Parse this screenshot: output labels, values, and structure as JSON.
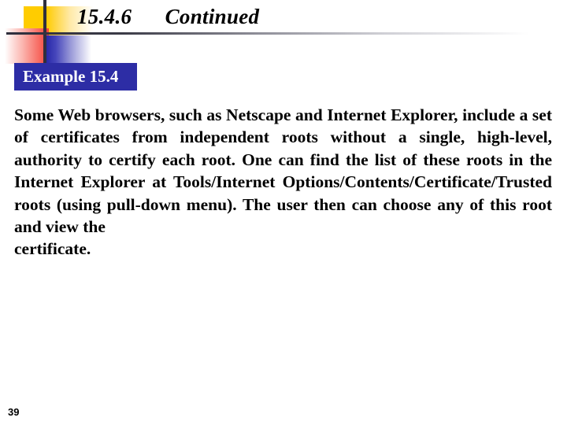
{
  "slide": {
    "title": "15.4.6      Continued",
    "page_number": "39",
    "badge": {
      "label": "Example 15.4",
      "background_color": "#2d2da5",
      "text_color": "#ffffff"
    },
    "body": {
      "paragraph": "Some Web browsers, such as Netscape and Internet Explorer, include a set of certificates from independent roots without a single, high-level, authority to certify each root. One can find the list of these roots in the Internet Explorer at Tools/Internet Options/Contents/Certificate/Trusted roots (using pull-down menu). The user then can choose any of this root and view the",
      "last_line": "certificate.",
      "lines": [
        "Some Web browsers, such as Netscape and Internet Explorer,",
        "include a set of certificates from independent roots without a",
        "single, high-level, authority to certify each root. One can find the",
        "list of these roots in the Internet Explorer at Tools/Internet",
        "Options/Contents/Certificate/Trusted  roots  (using  pull-down",
        "menu). The user then can choose any of this root and view the",
        "certificate."
      ]
    },
    "decoration": {
      "yellow_color": "#ffcc00",
      "red_color": "#f4423a",
      "blue_color": "#2626a8",
      "bar_color": "#2f2f3d",
      "rule_color": "#2f2f3d"
    }
  }
}
